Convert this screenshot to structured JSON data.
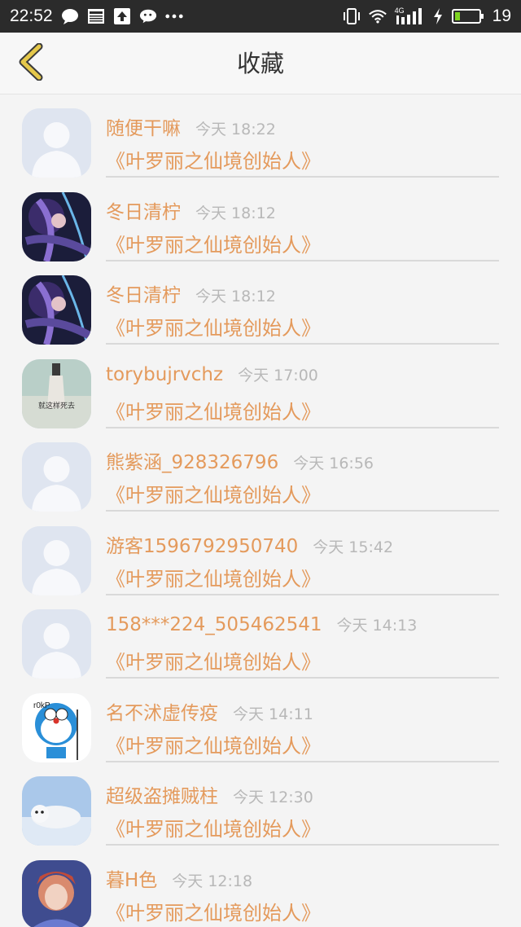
{
  "status_bar": {
    "time": "22:52",
    "battery_percent": "19",
    "network": "4G",
    "icons_left": [
      "chat-bubble-icon",
      "news-icon",
      "upload-icon",
      "wechat-icon",
      "more-dots-icon"
    ],
    "icons_right": [
      "vibrate-icon",
      "wifi-icon",
      "signal-icon",
      "charging-icon",
      "battery-icon"
    ]
  },
  "header": {
    "title": "收藏",
    "back_icon": "chevron-left-icon",
    "accent_color": "#e5c84a"
  },
  "colors": {
    "name": "#e49a5c",
    "time": "#b8b8b8",
    "divider": "#d9d9d9",
    "background": "#f4f4f4"
  },
  "items": [
    {
      "name": "随便干嘛",
      "time": "今天 18:22",
      "title": "《叶罗丽之仙境创始人》",
      "avatar": "default-avatar"
    },
    {
      "name": "冬日清柠",
      "time": "今天 18:12",
      "title": "《叶罗丽之仙境创始人》",
      "avatar": "anime-dark"
    },
    {
      "name": "冬日清柠",
      "time": "今天 18:12",
      "title": "《叶罗丽之仙境创始人》",
      "avatar": "anime-dark"
    },
    {
      "name": "torybujrvchz",
      "time": "今天 17:00",
      "title": "《叶罗丽之仙境创始人》",
      "avatar": "beach-figure",
      "avatar_caption": "就这样死去"
    },
    {
      "name": "熊紫涵_928326796",
      "time": "今天 16:56",
      "title": "《叶罗丽之仙境创始人》",
      "avatar": "default-avatar"
    },
    {
      "name": "游客1596792950740",
      "time": "今天 15:42",
      "title": "《叶罗丽之仙境创始人》",
      "avatar": "default-avatar"
    },
    {
      "name": "158***224_505462541",
      "time": "今天 14:13",
      "title": "《叶罗丽之仙境创始人》",
      "avatar": "default-avatar"
    },
    {
      "name": "名不沭虚传疫",
      "time": "今天 14:11",
      "title": "《叶罗丽之仙境创始人》",
      "avatar": "doraemon",
      "avatar_caption": "r0kP"
    },
    {
      "name": "超级盗摊贼柱",
      "time": "今天 12:30",
      "title": "《叶罗丽之仙境创始人》",
      "avatar": "seal"
    },
    {
      "name": "暮H色",
      "time": "今天 12:18",
      "title": "《叶罗丽之仙境创始人》",
      "avatar": "anime-boy"
    }
  ]
}
